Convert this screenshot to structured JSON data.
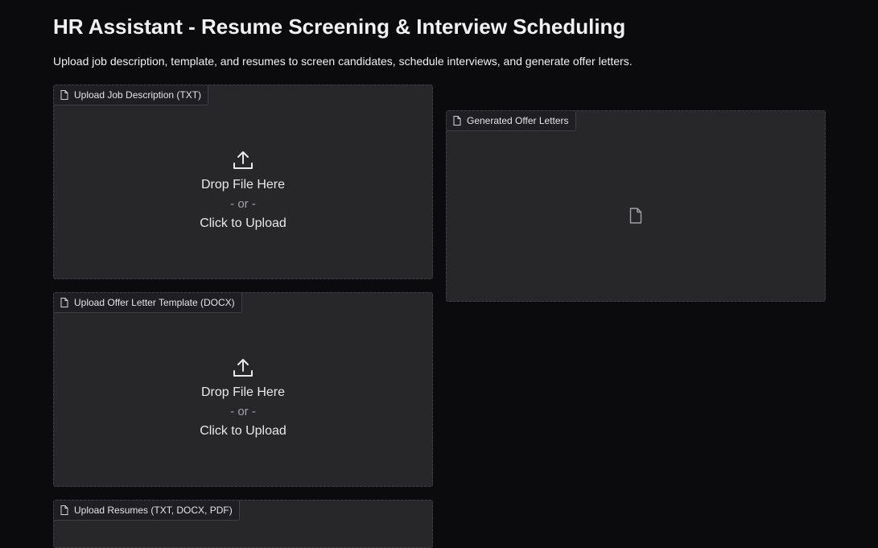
{
  "header": {
    "title": "HR Assistant - Resume Screening & Interview Scheduling",
    "subtitle": "Upload job description, template, and resumes to screen candidates, schedule interviews, and generate offer letters."
  },
  "uploads": [
    {
      "label": "Upload Job Description (TXT)",
      "drop_text": "Drop File Here",
      "or_text": "- or -",
      "click_text": "Click to Upload",
      "icon": "upload-icon"
    },
    {
      "label": "Upload Offer Letter Template (DOCX)",
      "drop_text": "Drop File Here",
      "or_text": "- or -",
      "click_text": "Click to Upload",
      "icon": "upload-icon"
    },
    {
      "label": "Upload Resumes (TXT, DOCX, PDF)",
      "icon": "upload-icon"
    }
  ],
  "output": {
    "label": "Generated Offer Letters",
    "empty_icon": "file-icon"
  },
  "colors": {
    "background": "#0b0b0d",
    "panel": "#27272a",
    "panel_border": "#3f3f46",
    "text": "#e8e8ea",
    "muted_text": "#a1a1aa"
  }
}
